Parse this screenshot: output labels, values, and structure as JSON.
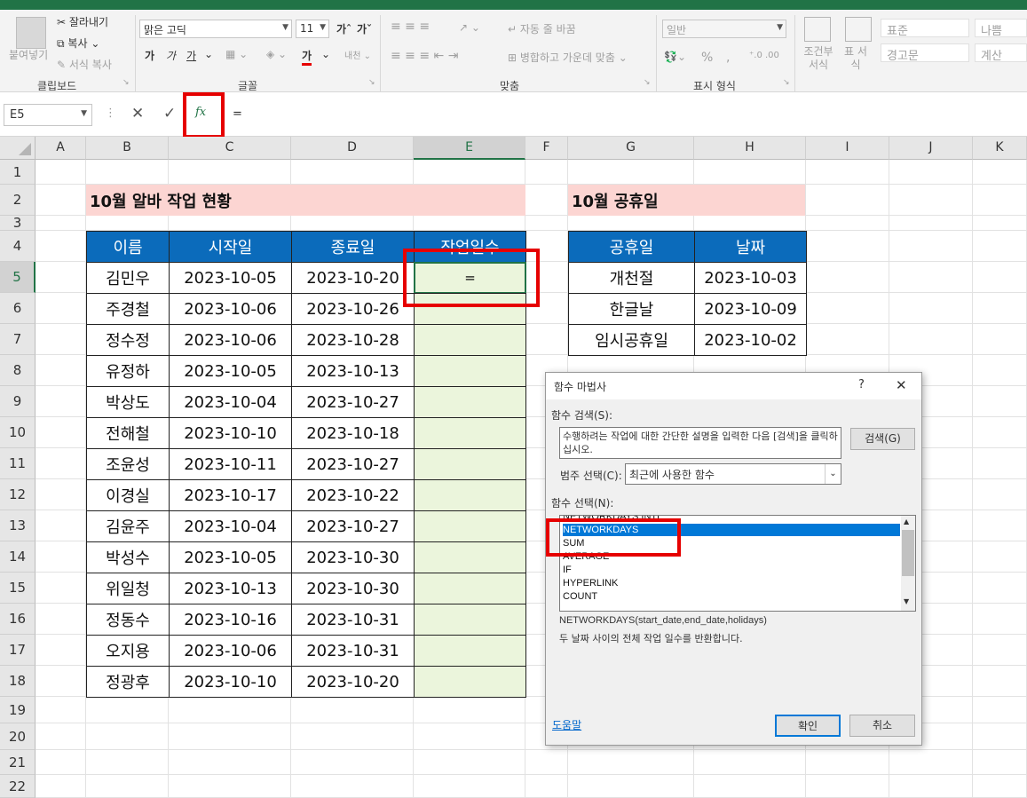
{
  "ribbon": {
    "clipboard": {
      "paste": "붙여넣기",
      "cut": "잘라내기",
      "copy": "복사",
      "format_painter": "서식 복사",
      "group_label": "클립보드"
    },
    "font": {
      "font_name": "맑은 고딕",
      "font_size": "11",
      "bold": "가",
      "italic": "가",
      "underline": "가",
      "font_color": "가",
      "group_label": "글꼴"
    },
    "alignment": {
      "wrap_text": "자동 줄 바꿈",
      "merge_center": "병합하고 가운데 맞춤",
      "group_label": "맞춤"
    },
    "number": {
      "format": "일반",
      "group_label": "표시 형식"
    },
    "styles": {
      "conditional": "조건부 서식",
      "table": "표 서식",
      "normal": "표준",
      "bad": "나쁨",
      "warning": "경고문",
      "calc": "계산"
    }
  },
  "formula_bar": {
    "name_box": "E5",
    "fx": "fx",
    "content": "="
  },
  "columns": [
    "A",
    "B",
    "C",
    "D",
    "E",
    "F",
    "G",
    "H",
    "I",
    "J",
    "K"
  ],
  "rows": [
    "1",
    "2",
    "3",
    "4",
    "5",
    "6",
    "7",
    "8",
    "9",
    "10",
    "11",
    "12",
    "13",
    "14",
    "15",
    "16",
    "17",
    "18",
    "19",
    "20",
    "21",
    "22"
  ],
  "work_table": {
    "title": "10월 알바 작업 현황",
    "headers": [
      "이름",
      "시작일",
      "종료일",
      "작업일수"
    ],
    "rows": [
      {
        "name": "김민우",
        "start": "2023-10-05",
        "end": "2023-10-20",
        "days": "="
      },
      {
        "name": "주경철",
        "start": "2023-10-06",
        "end": "2023-10-26",
        "days": ""
      },
      {
        "name": "정수정",
        "start": "2023-10-06",
        "end": "2023-10-28",
        "days": ""
      },
      {
        "name": "유정하",
        "start": "2023-10-05",
        "end": "2023-10-13",
        "days": ""
      },
      {
        "name": "박상도",
        "start": "2023-10-04",
        "end": "2023-10-27",
        "days": ""
      },
      {
        "name": "전해철",
        "start": "2023-10-10",
        "end": "2023-10-18",
        "days": ""
      },
      {
        "name": "조윤성",
        "start": "2023-10-11",
        "end": "2023-10-27",
        "days": ""
      },
      {
        "name": "이경실",
        "start": "2023-10-17",
        "end": "2023-10-22",
        "days": ""
      },
      {
        "name": "김윤주",
        "start": "2023-10-04",
        "end": "2023-10-27",
        "days": ""
      },
      {
        "name": "박성수",
        "start": "2023-10-05",
        "end": "2023-10-30",
        "days": ""
      },
      {
        "name": "위일청",
        "start": "2023-10-13",
        "end": "2023-10-30",
        "days": ""
      },
      {
        "name": "정동수",
        "start": "2023-10-16",
        "end": "2023-10-31",
        "days": ""
      },
      {
        "name": "오지용",
        "start": "2023-10-06",
        "end": "2023-10-31",
        "days": ""
      },
      {
        "name": "정광후",
        "start": "2023-10-10",
        "end": "2023-10-20",
        "days": ""
      }
    ]
  },
  "holiday_table": {
    "title": "10월 공휴일",
    "headers": [
      "공휴일",
      "날짜"
    ],
    "rows": [
      {
        "name": "개천절",
        "date": "2023-10-03"
      },
      {
        "name": "한글날",
        "date": "2023-10-09"
      },
      {
        "name": "임시공휴일",
        "date": "2023-10-02"
      }
    ]
  },
  "dialog": {
    "title": "함수 마법사",
    "help": "?",
    "close": "✕",
    "search_label": "함수 검색(S):",
    "search_text": "수행하려는 작업에 대한 간단한 설명을 입력한 다음 [검색]을 클릭하십시오.",
    "search_button": "검색(G)",
    "category_label": "범주 선택(C):",
    "category_value": "최근에 사용한 함수",
    "function_label": "함수 선택(N):",
    "functions": [
      "NETWORKDAYS.INTL",
      "NETWORKDAYS",
      "SUM",
      "AVERAGE",
      "IF",
      "HYPERLINK",
      "COUNT"
    ],
    "selected_index": 1,
    "signature": "NETWORKDAYS(start_date,end_date,holidays)",
    "description": "두 날짜 사이의 전체 작업 일수를 반환합니다.",
    "help_link": "도움말",
    "ok": "확인",
    "cancel": "취소"
  },
  "colors": {
    "accent": "#217346",
    "table_header": "#0b6bbb",
    "title_fill": "#fcd5d2",
    "selection_fill": "#ebf5dc",
    "highlight": "#e60000",
    "list_selection": "#0078d7"
  }
}
